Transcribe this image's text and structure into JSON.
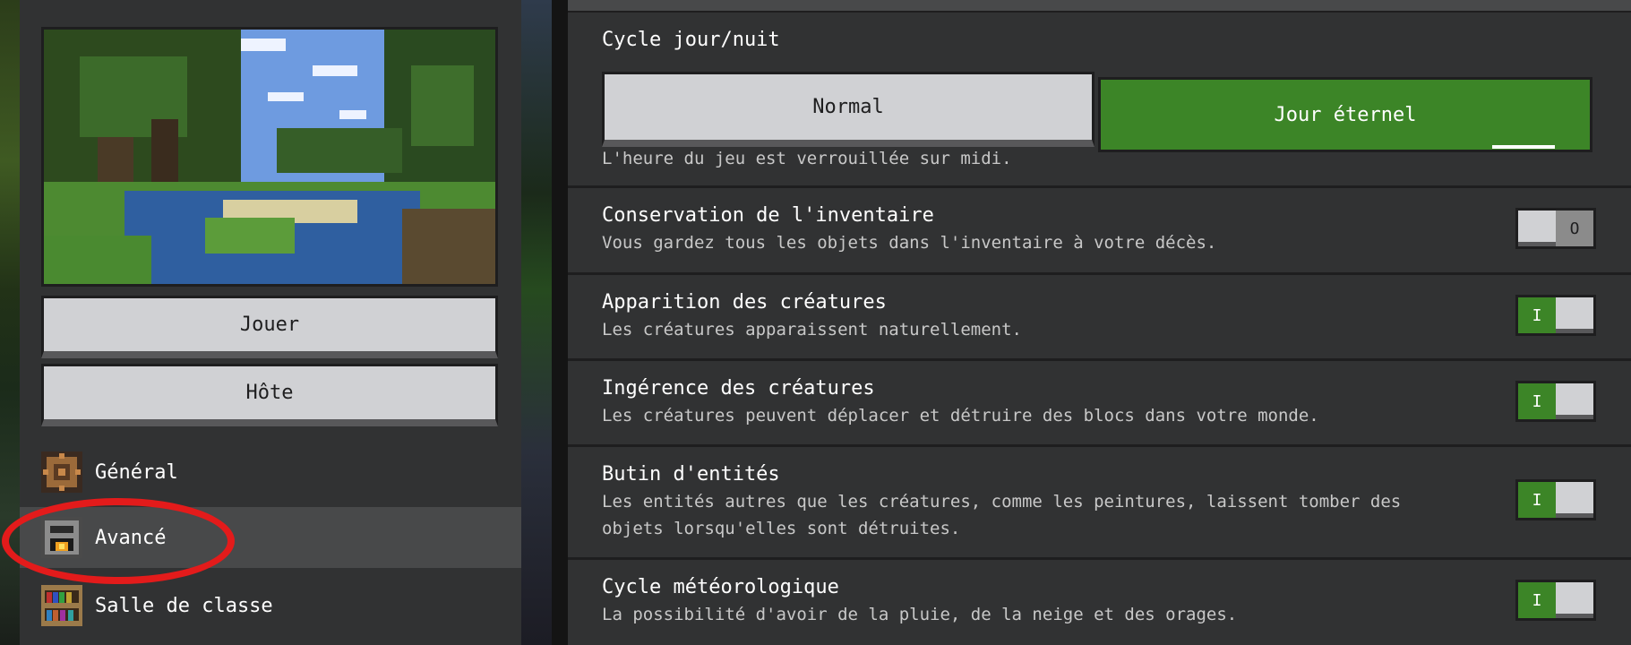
{
  "world_preview": {
    "icon": "landscape-thumbnail"
  },
  "buttons": {
    "play": "Jouer",
    "host": "Hôte"
  },
  "nav": {
    "items": [
      {
        "label": "Général",
        "icon": "gear-icon",
        "active": false
      },
      {
        "label": "Avancé",
        "icon": "furnace-icon",
        "active": true
      },
      {
        "label": "Salle de classe",
        "icon": "bookshelf-icon",
        "active": false
      }
    ]
  },
  "settings": {
    "day_cycle": {
      "title": "Cycle jour/nuit",
      "options": [
        "Normal",
        "Jour éternel"
      ],
      "selected": "Jour éternel",
      "description": "L'heure du jeu est verrouillée sur midi."
    },
    "keep_inventory": {
      "title": "Conservation de l'inventaire",
      "description": "Vous gardez tous les objets dans l'inventaire à votre décès.",
      "toggle": "O"
    },
    "mob_spawning": {
      "title": "Apparition des créatures",
      "description": "Les créatures apparaissent naturellement.",
      "toggle": "I"
    },
    "mob_griefing": {
      "title": "Ingérence des créatures",
      "description": "Les créatures peuvent déplacer et détruire des blocs dans votre monde.",
      "toggle": "I"
    },
    "entity_drops": {
      "title": "Butin d'entités",
      "description": "Les entités autres que les créatures, comme les peintures, laissent tomber des objets lorsqu'elles sont détruites.",
      "toggle": "I"
    },
    "weather_cycle": {
      "title": "Cycle météorologique",
      "description": "La possibilité d'avoir de la pluie, de la neige et des orages.",
      "toggle": "I"
    }
  },
  "colors": {
    "accent_green": "#3c8527",
    "panel": "#313233",
    "highlight_red": "#e31b1b"
  }
}
